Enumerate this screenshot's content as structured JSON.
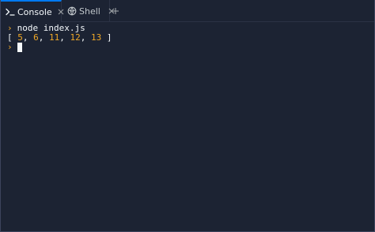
{
  "tabs": [
    {
      "label": "Console",
      "icon": "terminal-icon",
      "active": true
    },
    {
      "label": "Shell",
      "icon": "shell-icon",
      "active": false
    }
  ],
  "terminal": {
    "prompt_symbol": "›",
    "command": "node index.js",
    "output": {
      "open": "[ ",
      "numbers": [
        "5",
        "6",
        "11",
        "12",
        "13"
      ],
      "separator": ", ",
      "close": " ]"
    }
  },
  "colors": {
    "background": "#1c2333",
    "accent": "#0079f2",
    "prompt": "#f0a827",
    "number": "#f0a827",
    "text": "#f5f9fc"
  }
}
